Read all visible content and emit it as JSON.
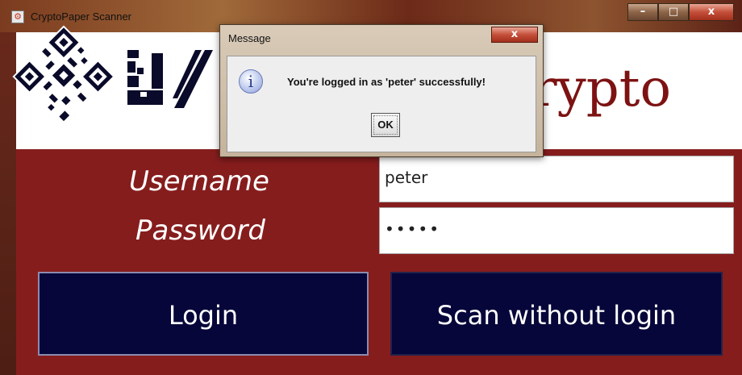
{
  "window": {
    "title": "CryptoPaper Scanner",
    "minimize": "–",
    "maximize": "□",
    "close": "x"
  },
  "banner": {
    "brand_partial": "rypto",
    "colors": {
      "brand": "#7d1212"
    }
  },
  "form": {
    "username_label": "Username",
    "password_label": "Password",
    "username_value": "peter",
    "password_masked": "•••••",
    "login_label": "Login",
    "scan_label": "Scan without login",
    "colors": {
      "panel": "#861d1d",
      "button": "#06063a"
    }
  },
  "dialog": {
    "title": "Message",
    "close": "x",
    "icon": "info-icon",
    "icon_glyph": "i",
    "message": "You're logged in as 'peter' successfully!",
    "ok_label": "OK"
  }
}
